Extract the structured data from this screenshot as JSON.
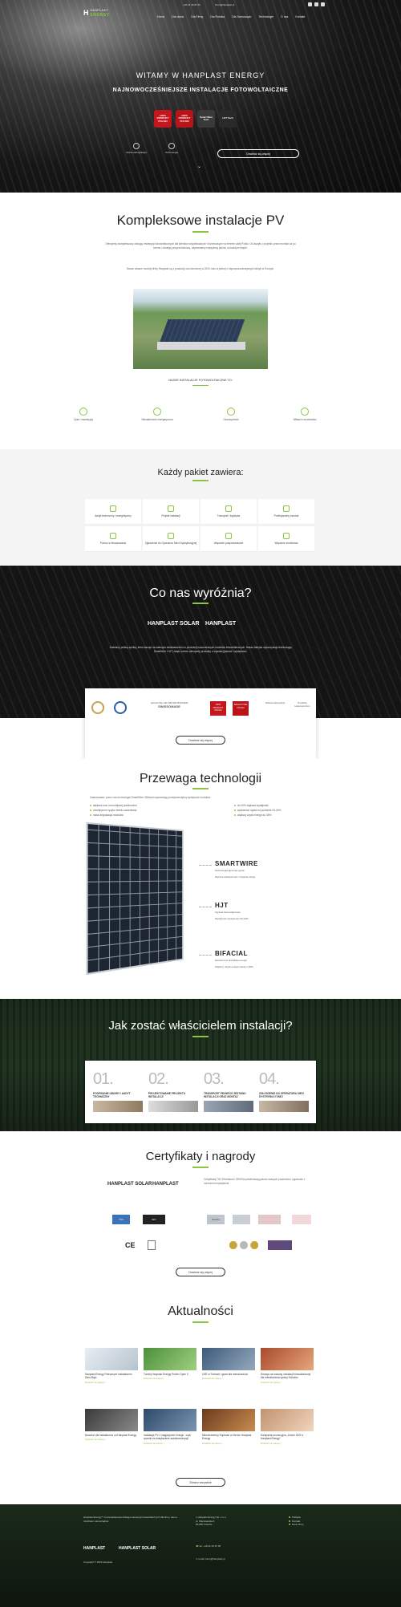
{
  "header": {
    "phone": "+48 22 49 87 66",
    "email": "biuro@hanplast.pl",
    "logo_mark": "H",
    "logo_text1": "HANPLAST",
    "logo_text2": "ENERGY",
    "menu": [
      "Home",
      "Dla domu",
      "Dla Firmy",
      "Dla Rolnika",
      "Dla Samorządu",
      "Technologie",
      "O nas",
      "Kontakt"
    ]
  },
  "hero": {
    "title": "WITAMY W HANPLAST ENERGY",
    "subtitle": "NAJNOWOCZEŚNIEJSZE INSTALACJE FOTOWOLTAICZNE",
    "badges": [
      {
        "label": "100% PRODUKT POLSKI",
        "color": "#c4161c"
      },
      {
        "label": "100% PRODUKT POLSKI",
        "color": "#b8141a"
      },
      {
        "label": "Smart Wire Tech",
        "color": "#3a3a3a"
      },
      {
        "label": "HJT Tech",
        "color": "#2a2a2a"
      }
    ],
    "features": [
      "Dobra identyfikacja",
      "Technologia"
    ],
    "cta": "Dowiedz się więcej"
  },
  "complex": {
    "title": "Kompleksowe instalacje PV",
    "p1": "Oferujemy kompleksową obsługę inwestycji fotowoltaicznych dla klientów indywidualnych i biznesowych na terenie całej Polski. Od audytu i projektu przez montaż aż po serwis i obsługę posprzedażową, zapewniamy najwyższą jakość na każdym etapie.",
    "p2": "Nasze własne moduły firmy Hanplast są z produkcji uruchomionej w 2020 roku w jednej z najnowocześniejszych fabryk w Europie.",
    "list_title": "NASZE INSTALACJE FOTOWOLTAICZNE TO:",
    "features": [
      "Zysk i inwestycja",
      "Niezależność energetyczna",
      "Oszczędność",
      "Wkład w środowisko"
    ]
  },
  "package": {
    "title": "Każdy pakiet zawiera:",
    "items": [
      "Audyt techniczny i energetyczny",
      "Projekt instalacji",
      "Transport i logistyka",
      "Profesjonalny montaż",
      "Pomoc w finansowaniu",
      "Zgłoszenie do Operatora Sieci Dystrybucyjnej",
      "Wsparcie posprzedażowe",
      "Wsparcie serwisowe"
    ]
  },
  "distinct": {
    "title": "Co nas wyróżnia?",
    "logo1": "HANPLAST SOLAR",
    "logo2": "HANPLAST",
    "text": "Jesteśmy polską spółką, która bazuje na własnym doświadczeniu w produkcji nowoczesnych modułów fotowoltaicznych. Nasza fabryka wykorzystuje technologię SmartWire i HJT, dzięki czemu oferujemy produkty o wysokiej jakości i wydajności.",
    "certs": [
      "partnership with MEYER BURGER",
      "SWISSOMADE",
      "100% PRODUKT POLSKI",
      "ABSOLUTNIE POLSKI",
      "Global partnership",
      "Produkty Heterojunction"
    ],
    "cta": "Dowiedz się więcej"
  },
  "tech": {
    "title": "Przewaga technologii",
    "intro": "Zastosowane przez nas technologie SmartWire i Bifacial zapewniają ponadprzeciętną wydajność modułów.",
    "bullets_left": [
      "większa moc na mniejszej powierzchni",
      "zmniejszone ryzyko efektu zacieniania",
      "niska degradacja modułów"
    ],
    "bullets_right": [
      "do 10% większa wydajność",
      "sprawność ogniw na poziomie 23-24%",
      "większy uzysk energii do 30%"
    ],
    "items": [
      {
        "name": "SMARTWIRE",
        "sub": "Technologia łączenia ogniw",
        "desc": "Wyższa efektywność i mniejsze straty"
      },
      {
        "name": "HJT",
        "sub": "Ogniwa heterozłączowe",
        "desc": "Wydajność sprawności 23-24%"
      },
      {
        "name": "BIFACIAL",
        "sub": "Dwustronna produkcja energii",
        "desc": "Większy uzysk energii nawet o 30%"
      }
    ]
  },
  "steps": {
    "title": "Jak zostać właścicielem instalacji?",
    "items": [
      {
        "n": "01.",
        "t": "PODPISANIE UMOWY I AUDYT TECHNICZNY"
      },
      {
        "n": "02.",
        "t": "PROJEKTOWANIE PROJEKTU INSTALACJI"
      },
      {
        "n": "03.",
        "t": "TRANSPORT PEŁNEGO ZESTAWU INSTALACJI ORAZ MONTAŻ"
      },
      {
        "n": "04.",
        "t": "ZGŁOSZENIE DO OPERATORA SIECI DYSTRYBUCYJNEJ"
      }
    ]
  },
  "certs": {
    "title": "Certyfikaty i nagrody",
    "logo1": "HANPLAST SOLAR",
    "logo2": "HANPLAST",
    "text": "Certyfikaty TÜV Rheinland i DEKRA potwierdzają jakość naszych produktów i zgodność z normami europejskimi.",
    "cta": "Dowiedz się więcej",
    "marks": [
      "TÜV",
      "IEC",
      "DEKRA",
      "CE",
      "CE"
    ]
  },
  "news": {
    "title": "Aktualności",
    "items": [
      {
        "t": "Hanplast Energy Polecanym Instalatorem Daro-Bigo",
        "more": "Dowiedz się więcej >",
        "c1": "#e8eef3",
        "c2": "#b6c3cf"
      },
      {
        "t": "Turniej Hanplast Energy Profen Open V",
        "more": "Dowiedz się więcej >",
        "c1": "#4c8f3b",
        "c2": "#9fcf7f"
      },
      {
        "t": "OZE w Turbach i grant dla mieszkańców",
        "more": "Dowiedz się więcej >",
        "c1": "#3d5a7a",
        "c2": "#95a9bd"
      },
      {
        "t": "Dotacja na budowę instalacji fotowoltaicznej dla mieszkańców gminy Sokolów",
        "more": "Dowiedz się więcej >",
        "c1": "#a84a2c",
        "c2": "#e6a77b"
      },
      {
        "t": "Nowości dla instalatorów od Hanplast Energy",
        "more": "Dowiedz się więcej >",
        "c1": "#3a3a3a",
        "c2": "#8a8a8a"
      },
      {
        "t": "Instalacje PV z magazynem energii - czyli sposób na zwiększenie autokonsumpcji",
        "more": "Dowiedz się więcej >",
        "c1": "#2e4a6b",
        "c2": "#7a95b0"
      },
      {
        "t": "Mikroinwertery Enphase w ofercie Hanplast Energy",
        "more": "Dowiedz się więcej >",
        "c1": "#6a3b1e",
        "c2": "#c98c52"
      },
      {
        "t": "Kampania promocyjna „Jesień 2020 z Hanplast Energy”",
        "more": "Dowiedz się więcej >",
        "c1": "#c1936f",
        "c2": "#f1d5bd"
      }
    ],
    "cta": "Zobacz wszystkie"
  },
  "footer": {
    "about": "Hanplast Energy™ to kompleksowa obsługa inwestycji fotowoltaicznych dla firmy, domu, rolnictwa i samorządów.",
    "copyright": "Copyright © 2020 Hanplast",
    "company": "Hanplast Energy Sp. z o.o.",
    "address1": "ul. Warszawska 4",
    "address2": "05-850 Ożarów",
    "phone": "tel. +48 22 49 87 66",
    "email": "email: biuro@hanplast.pl",
    "links": [
      "Polityka",
      "Kontakt",
      "Dane firmy"
    ]
  }
}
